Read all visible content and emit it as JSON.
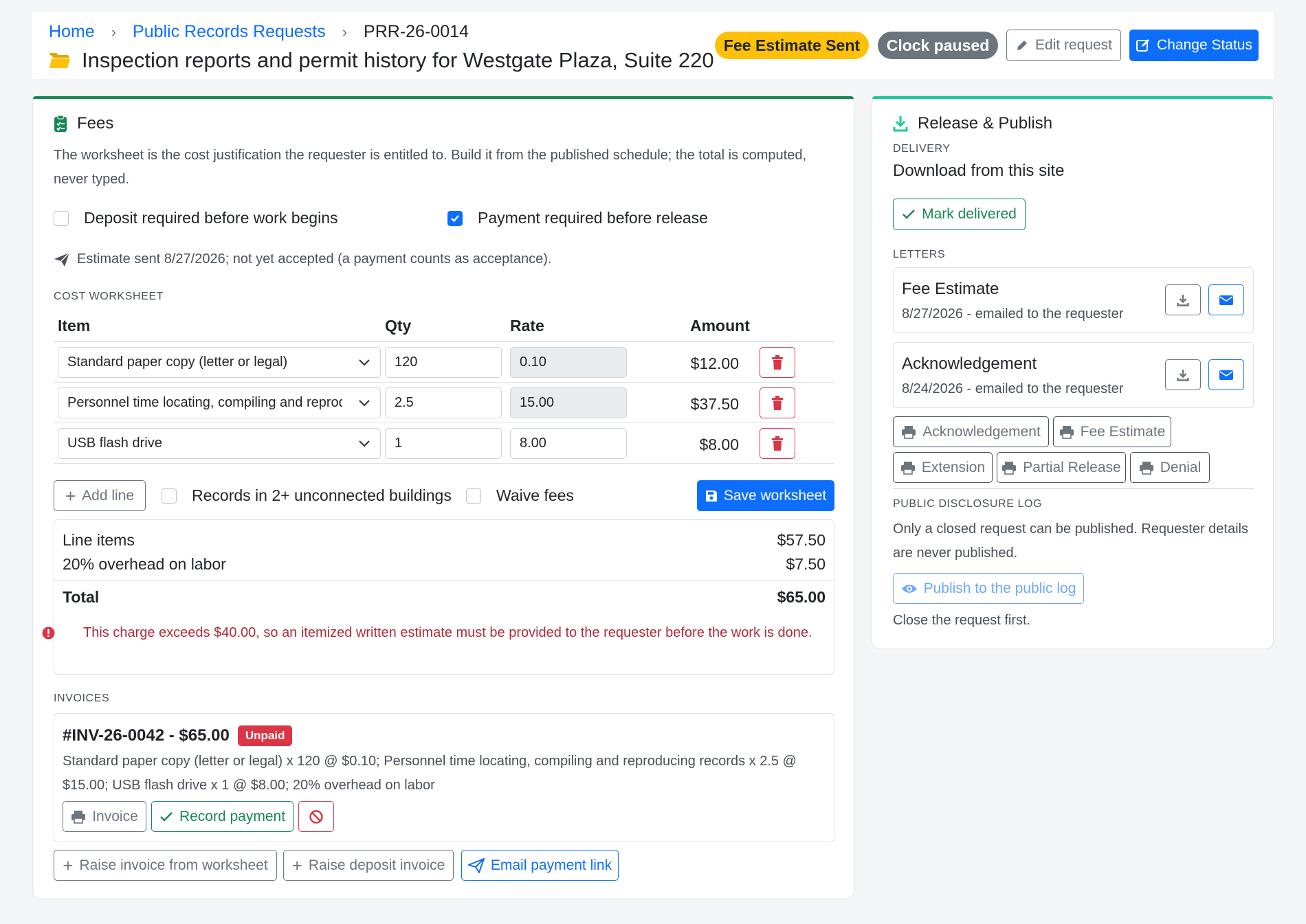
{
  "header": {
    "breadcrumb": [
      "Home",
      "Public Records Requests",
      "PRR-26-0014"
    ],
    "title": "Inspection reports and permit history for Westgate Plaza, Suite 220",
    "status_badge": "Fee Estimate Sent",
    "clock_badge": "Clock paused",
    "edit_label": "Edit request",
    "change_status_label": "Change Status",
    "colors": {
      "accent": "#0d6efd",
      "status_badge": "#ffc107",
      "clock_badge": "#6c757d"
    }
  },
  "fees": {
    "title": "Fees",
    "intro": "The worksheet is the cost justification the requester is entitled to. Build it from the published schedule; the total is computed, never typed.",
    "deposit_label": "Deposit required before work begins",
    "deposit_checked": false,
    "payment_label": "Payment required before release",
    "payment_checked": true,
    "estimate_note": "Estimate sent 8/27/2026; not yet accepted (a payment counts as acceptance).",
    "worksheet_heading": "COST WORKSHEET",
    "columns": [
      "Item",
      "Qty",
      "Rate",
      "Amount"
    ],
    "lines": [
      {
        "item": "Standard paper copy (letter or legal)",
        "qty": "120",
        "rate": "0.10",
        "amount": "$12.00",
        "rate_readonly": true
      },
      {
        "item": "Personnel time locating, compiling and reproducing records",
        "qty": "2.5",
        "rate": "15.00",
        "amount": "$37.50",
        "rate_readonly": true
      },
      {
        "item": "USB flash drive",
        "qty": "1",
        "rate": "8.00",
        "amount": "$8.00",
        "rate_readonly": false
      }
    ],
    "add_line_label": "Add line",
    "buildings_label": "Records in 2+ unconnected buildings",
    "buildings_checked": false,
    "waive_label": "Waive fees",
    "waive_checked": false,
    "save_label": "Save worksheet",
    "summary": {
      "line_items_label": "Line items",
      "line_items_value": "$57.50",
      "overhead_label": "20% overhead on labor",
      "overhead_value": "$7.50",
      "total_label": "Total",
      "total_value": "$65.00",
      "warning": "This charge exceeds $40.00, so an itemized written estimate must be provided to the requester before the work is done."
    },
    "invoices_heading": "INVOICES",
    "invoice": {
      "title": "#INV-26-0042 - $65.00",
      "badge": "Unpaid",
      "detail": "Standard paper copy (letter or legal) x 120 @ $0.10; Personnel time locating, compiling and reproducing records x 2.5 @ $15.00; USB flash drive x 1 @ $8.00; 20% overhead on labor",
      "invoice_btn": "Invoice",
      "record_payment_btn": "Record payment"
    },
    "raise_from_worksheet": "Raise invoice from worksheet",
    "raise_deposit": "Raise deposit invoice",
    "email_payment_link": "Email payment link"
  },
  "release": {
    "title": "Release & Publish",
    "delivery_heading": "DELIVERY",
    "delivery_value": "Download from this site",
    "mark_delivered": "Mark delivered",
    "letters_heading": "LETTERS",
    "letters": [
      {
        "name": "Fee Estimate",
        "sub": "8/27/2026 - emailed to the requester"
      },
      {
        "name": "Acknowledgement",
        "sub": "8/24/2026 - emailed to the requester"
      }
    ],
    "print_buttons": [
      "Acknowledgement",
      "Fee Estimate",
      "Extension",
      "Partial Release",
      "Denial"
    ],
    "log_heading": "PUBLIC DISCLOSURE LOG",
    "log_text": "Only a closed request can be published. Requester details are never published.",
    "publish_label": "Publish to the public log",
    "close_first": "Close the request first."
  }
}
